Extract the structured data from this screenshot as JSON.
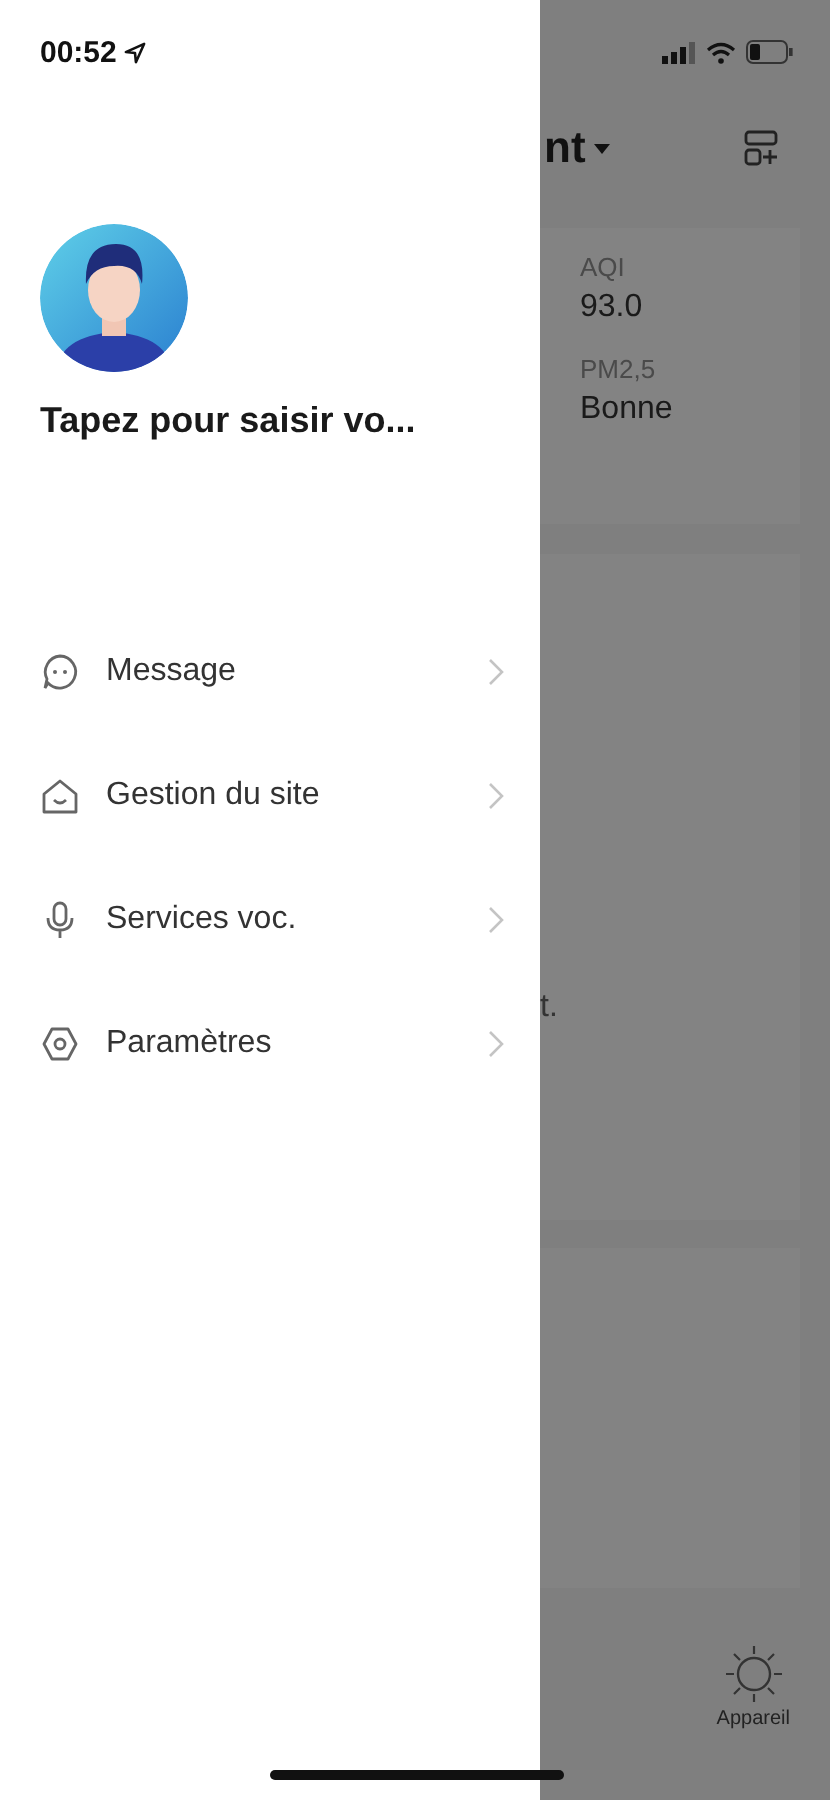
{
  "status_bar": {
    "time": "00:52"
  },
  "profile": {
    "prompt": "Tapez pour saisir vo..."
  },
  "menu": [
    {
      "kind": "message",
      "label": "Message"
    },
    {
      "kind": "site",
      "label": "Gestion du site"
    },
    {
      "kind": "voice",
      "label": "Services voc."
    },
    {
      "kind": "settings",
      "label": "Paramètres"
    }
  ],
  "background": {
    "title_fragment": "nt",
    "metrics": [
      {
        "label": "AQI",
        "value": "93.0"
      },
      {
        "label": "PM2,5",
        "value": "Bonne"
      }
    ],
    "text_fragment": "t.",
    "tab": "Appareil"
  }
}
